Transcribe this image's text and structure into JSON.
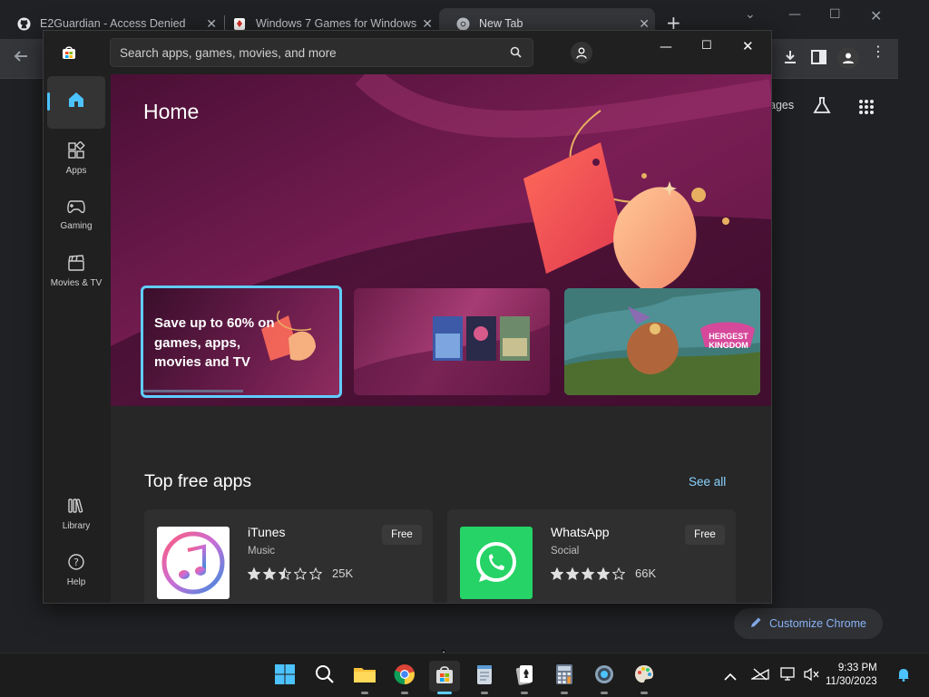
{
  "chrome": {
    "tabs": [
      {
        "title": "E2Guardian - Access Denied",
        "favicon": "github-icon"
      },
      {
        "title": "Windows 7 Games for Windows",
        "favicon": "solitaire-icon"
      },
      {
        "title": "New Tab",
        "favicon": "chrome-icon"
      }
    ],
    "new_tab_symbol": "+",
    "partial_link_text": "ages",
    "customize_label": "Customize Chrome"
  },
  "store": {
    "search_placeholder": "Search apps, games, movies, and more",
    "nav": [
      {
        "label": "",
        "icon": "home-icon"
      },
      {
        "label": "Apps",
        "icon": "apps-icon"
      },
      {
        "label": "Gaming",
        "icon": "gamepad-icon"
      },
      {
        "label": "Movies & TV",
        "icon": "clapperboard-icon"
      }
    ],
    "nav_bottom": [
      {
        "label": "Library",
        "icon": "library-icon"
      },
      {
        "label": "Help",
        "icon": "help-icon"
      }
    ],
    "home_title": "Home",
    "promo_text": "Save up to 60% on games, apps, movies and TV",
    "promo3_logo": "HERGEST KINGDOM",
    "section_title": "Top free apps",
    "see_all": "See all",
    "apps": [
      {
        "name": "iTunes",
        "category": "Music",
        "price": "Free",
        "rating": 2.5,
        "count": "25K"
      },
      {
        "name": "WhatsApp",
        "category": "Social",
        "price": "Free",
        "rating": 4,
        "count": "66K"
      }
    ]
  },
  "taskbar": {
    "time": "9:33 PM",
    "date": "11/30/2023"
  },
  "colors": {
    "accent": "#60cdff",
    "whatsapp": "#25d366"
  }
}
